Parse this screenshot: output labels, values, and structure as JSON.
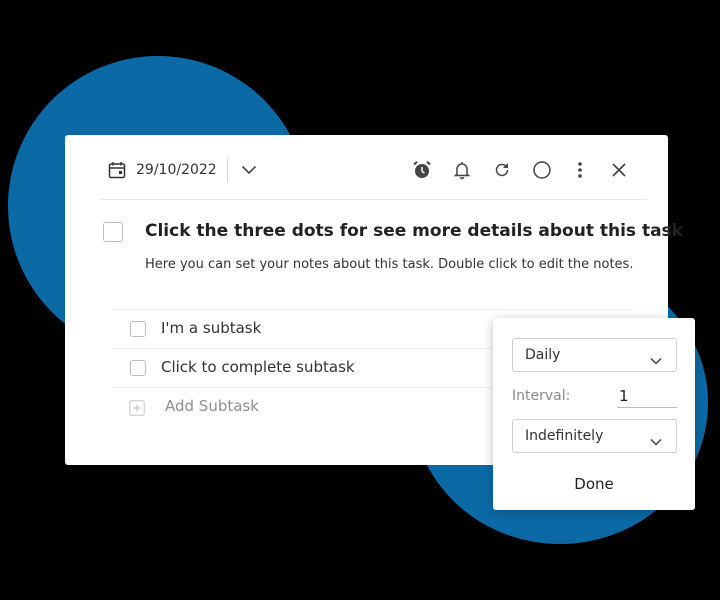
{
  "background": {
    "color": "#000000",
    "accent": "#0b6aa6"
  },
  "toolbar": {
    "date": "29/10/2022",
    "icons": [
      "calendar-icon",
      "chevron-down-icon",
      "alarm-clock-icon",
      "bell-icon",
      "repeat-icon",
      "circle-icon",
      "more-vertical-icon",
      "close-icon"
    ]
  },
  "task": {
    "title": "Click the three dots for see more details about this task",
    "notes": "Here you can set your notes about this task. Double click to edit the notes."
  },
  "subtasks": [
    {
      "label": "I'm a subtask"
    },
    {
      "label": "Click to complete subtask"
    }
  ],
  "add_subtask": {
    "label": "Add Subtask"
  },
  "repeat_popup": {
    "frequency": "Daily",
    "interval_label": "Interval:",
    "interval_value": "1",
    "end": "Indefinitely",
    "done_label": "Done"
  }
}
